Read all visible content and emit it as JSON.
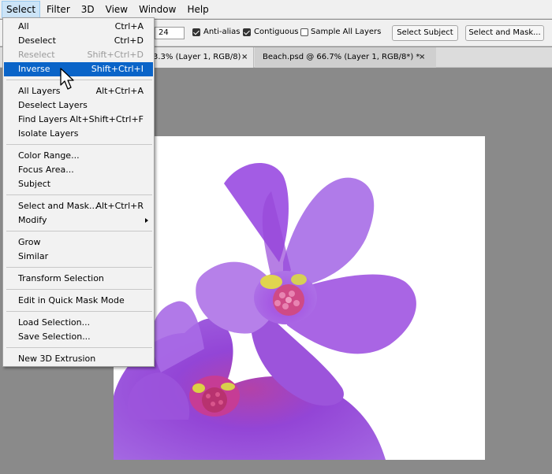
{
  "menubar": {
    "items": [
      "Select",
      "Filter",
      "3D",
      "View",
      "Window",
      "Help"
    ]
  },
  "options": {
    "tolerance": "24",
    "anti_alias": "Anti-alias",
    "contiguous": "Contiguous",
    "sample_all": "Sample All Layers",
    "select_subject": "Select Subject",
    "select_and_mask": "Select and Mask..."
  },
  "tabs": {
    "tab1": "3.3% (Layer 1, RGB/8)",
    "tab2": "Beach.psd @ 66.7% (Layer 1, RGB/8*) *",
    "close": "×"
  },
  "menu": {
    "all": {
      "label": "All",
      "shortcut": "Ctrl+A"
    },
    "deselect": {
      "label": "Deselect",
      "shortcut": "Ctrl+D"
    },
    "reselect": {
      "label": "Reselect",
      "shortcut": "Shift+Ctrl+D"
    },
    "inverse": {
      "label": "Inverse",
      "shortcut": "Shift+Ctrl+I"
    },
    "all_layers": {
      "label": "All Layers",
      "shortcut": "Alt+Ctrl+A"
    },
    "deselect_layers": {
      "label": "Deselect Layers"
    },
    "find_layers": {
      "label": "Find Layers",
      "shortcut": "Alt+Shift+Ctrl+F"
    },
    "isolate_layers": {
      "label": "Isolate Layers"
    },
    "color_range": {
      "label": "Color Range..."
    },
    "focus_area": {
      "label": "Focus Area..."
    },
    "subject": {
      "label": "Subject"
    },
    "select_and_mask": {
      "label": "Select and Mask...",
      "shortcut": "Alt+Ctrl+R"
    },
    "modify": {
      "label": "Modify"
    },
    "grow": {
      "label": "Grow"
    },
    "similar": {
      "label": "Similar"
    },
    "transform_selection": {
      "label": "Transform Selection"
    },
    "quick_mask": {
      "label": "Edit in Quick Mask Mode"
    },
    "load_selection": {
      "label": "Load Selection..."
    },
    "save_selection": {
      "label": "Save Selection..."
    },
    "new_3d_extrusion": {
      "label": "New 3D Extrusion"
    }
  },
  "colors": {
    "highlight": "#0a64c8",
    "petal": "#a45be0",
    "petal_dark": "#7e34c4",
    "center_pink": "#d43d8f",
    "stamen_yellow": "#e2d64c"
  }
}
